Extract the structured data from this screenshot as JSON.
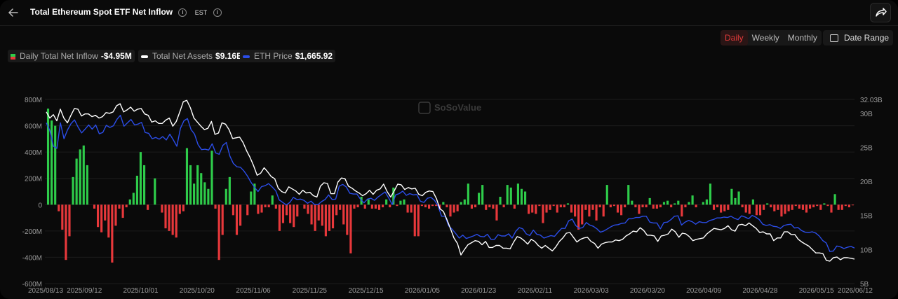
{
  "header": {
    "title": "Total Ethereum Spot ETF Net Inflow",
    "timezone": "EST"
  },
  "controls": {
    "periods": [
      "Daily",
      "Weekly",
      "Monthly"
    ],
    "active_period": "Daily",
    "date_range_label": "Date Range"
  },
  "legend": {
    "items": [
      {
        "label": "Daily Total Net Inflow",
        "value": "-$4.95M"
      },
      {
        "label": "Total Net Assets",
        "value": "$9.16B"
      },
      {
        "label": "ETH Price",
        "value": "$1,665.92"
      }
    ]
  },
  "watermark": "SoSoValue",
  "colors": {
    "positive": "#2ecc4a",
    "negative": "#e8383b",
    "assets_line": "#ffffff",
    "price_line": "#2b4de8",
    "active_tab": "#e23a3a"
  },
  "chart_data": {
    "type": "bar+line",
    "y_left": {
      "ticks": [
        "800M",
        "600M",
        "400M",
        "200M",
        "0",
        "-200M",
        "-400M",
        "-600M"
      ],
      "range": [
        -600,
        800
      ],
      "unit": "M"
    },
    "y_right": {
      "ticks": [
        "32.03B",
        "30B",
        "25B",
        "20B",
        "15B",
        "10B",
        "5B"
      ],
      "range": [
        5,
        32.03
      ],
      "unit": "B"
    },
    "x_ticks": [
      "2025/08/13",
      "2025/09/12",
      "2025/10/01",
      "2025/10/20",
      "2025/11/06",
      "2025/11/25",
      "2025/12/15",
      "2026/01/05",
      "2026/01/23",
      "2026/02/11",
      "2026/03/03",
      "2026/03/20",
      "2026/04/09",
      "2026/04/28",
      "2026/05/15",
      "2026/06/12"
    ],
    "inflow_bars_M": [
      730,
      640,
      600,
      -50,
      -190,
      -420,
      -240,
      210,
      350,
      420,
      450,
      300,
      0,
      -30,
      -170,
      -210,
      -120,
      -250,
      -440,
      -160,
      -30,
      -100,
      -20,
      40,
      90,
      220,
      400,
      300,
      -40,
      0,
      200,
      0,
      -60,
      -180,
      -200,
      -230,
      -250,
      -70,
      -50,
      430,
      300,
      160,
      300,
      240,
      170,
      120,
      410,
      -30,
      -420,
      -230,
      120,
      210,
      -80,
      -230,
      -160,
      0,
      -80,
      100,
      160,
      -70,
      -60,
      -20,
      -20,
      70,
      -30,
      -200,
      -140,
      -80,
      -140,
      -170,
      -90,
      0,
      -30,
      -70,
      -150,
      -200,
      -120,
      -160,
      -240,
      -200,
      -180,
      -80,
      -40,
      -150,
      -230,
      -370,
      -30,
      -20,
      60,
      -30,
      40,
      -30,
      -30,
      -40,
      -20,
      40,
      -20,
      130,
      -10,
      30,
      40,
      -60,
      -60,
      -240,
      -240,
      -10,
      -20,
      -30,
      -10,
      -10,
      -40,
      20,
      -20,
      -90,
      -60,
      -50,
      20,
      40,
      160,
      -30,
      -20,
      90,
      150,
      -40,
      -20,
      -30,
      -120,
      60,
      -20,
      150,
      130,
      -30,
      160,
      120,
      100,
      -70,
      -60,
      -70,
      -10,
      -140,
      -60,
      -40,
      -10,
      -60,
      -20,
      -20,
      10,
      -60,
      -90,
      -190,
      -150,
      -40,
      -90,
      -40,
      -120,
      -20,
      -90,
      150,
      -20,
      -10,
      -60,
      -80,
      -20,
      150,
      30,
      -20,
      -70,
      -20,
      -20,
      50,
      -30,
      -30,
      -20,
      20,
      30,
      -20,
      10,
      30,
      -90,
      -20,
      20,
      70,
      -20,
      0,
      20,
      40,
      160,
      -40,
      -20,
      -60,
      -50,
      -40,
      120,
      50,
      100,
      -20,
      -60,
      -70,
      40,
      -80,
      -80,
      -40,
      10,
      -20,
      -50,
      -40,
      -90,
      -70,
      -50,
      -40,
      -10,
      -30,
      -40,
      -60,
      -30,
      -20,
      -10,
      -40,
      10,
      -10,
      -60,
      80,
      -40,
      -40,
      -10,
      -20,
      -5
    ],
    "total_net_assets_B": [
      30.2,
      29.3,
      29.8,
      28.9,
      30.6,
      29.3,
      28.6,
      29.7,
      30.7,
      30.6,
      29.6,
      29.9,
      29.9,
      29.5,
      29.7,
      29.3,
      29.5,
      30.1,
      30.0,
      30.2,
      31.1,
      31.4,
      30.2,
      30.5,
      30.9,
      30.3,
      30.6,
      30.7,
      29.9,
      29.7,
      28.7,
      28.9,
      28.5,
      28.5,
      29.0,
      29.3,
      28.1,
      28.8,
      30.2,
      31.7,
      31.9,
      30.8,
      29.3,
      28.7,
      28.1,
      27.6,
      27.8,
      28.8,
      26.9,
      27.1,
      28.6,
      28.4,
      27.6,
      26.3,
      26.4,
      26.5,
      25.7,
      24.5,
      23.5,
      22.3,
      20.9,
      21.2,
      22.0,
      21.4,
      20.7,
      20.4,
      19.0,
      18.5,
      18.3,
      19.2,
      18.9,
      18.6,
      18.1,
      18.7,
      18.3,
      18.4,
      17.9,
      17.7,
      19.3,
      19.8,
      19.7,
      18.2,
      18.2,
      19.9,
      20.5,
      20.4,
      19.3,
      19.0,
      18.6,
      18.3,
      17.9,
      18.2,
      18.7,
      18.1,
      18.7,
      18.9,
      19.6,
      18.5,
      17.7,
      18.6,
      19.6,
      19.5,
      18.8,
      19.1,
      18.9,
      19.0,
      18.1,
      17.9,
      18.4,
      18.6,
      18.5,
      17.5,
      16.0,
      15.6,
      14.4,
      13.1,
      11.7,
      10.9,
      9.2,
      10.0,
      10.7,
      11.0,
      11.3,
      11.2,
      10.7,
      11.2,
      10.3,
      10.3,
      10.6,
      10.6,
      10.2,
      10.2,
      10.1,
      11.1,
      11.9,
      11.7,
      11.3,
      10.8,
      11.5,
      11.2,
      10.6,
      10.2,
      10.6,
      10.2,
      9.8,
      10.4,
      11.2,
      11.7,
      12.4,
      12.5,
      11.8,
      11.1,
      11.5,
      11.7,
      11.8,
      11.2,
      10.9,
      10.2,
      10.8,
      11.0,
      11.1,
      11.1,
      11.4,
      11.3,
      11.5,
      12.0,
      12.3,
      12.7,
      12.6,
      13.2,
      12.8,
      12.1,
      12.1,
      12.0,
      11.2,
      12.0,
      12.1,
      12.3,
      13.0,
      12.6,
      11.8,
      12.4,
      12.3,
      11.9,
      11.3,
      11.5,
      11.6,
      11.7,
      12.3,
      12.7,
      13.1,
      13.0,
      12.9,
      13.1,
      13.5,
      12.9,
      12.7,
      13.6,
      13.7,
      13.5,
      13.9,
      13.5,
      13.1,
      12.5,
      12.6,
      12.3,
      12.3,
      11.3,
      11.7,
      11.7,
      12.6,
      12.6,
      12.2,
      12.2,
      11.5,
      11.1,
      10.8,
      10.5,
      10.0,
      9.5,
      9.5,
      9.4,
      8.4,
      8.3,
      8.8,
      8.9,
      8.5,
      8.8,
      8.8,
      8.7,
      8.6
    ],
    "eth_price": [
      4650,
      4470,
      4090,
      4040,
      4650,
      4270,
      4480,
      4630,
      4720,
      4550,
      4410,
      4500,
      4600,
      4500,
      4600,
      4390,
      4420,
      4590,
      4540,
      4580,
      4730,
      4830,
      4570,
      4650,
      4730,
      4600,
      4620,
      4660,
      4420,
      4400,
      4270,
      4300,
      4260,
      4320,
      4240,
      4380,
      4240,
      4090,
      4520,
      4700,
      4750,
      4490,
      4380,
      4130,
      4010,
      4020,
      4000,
      4150,
      3930,
      3900,
      4110,
      4180,
      3860,
      3680,
      3600,
      3590,
      3500,
      3380,
      3230,
      3110,
      3010,
      3130,
      3150,
      3200,
      3120,
      3030,
      2810,
      2750,
      2690,
      2750,
      2870,
      2820,
      2830,
      2800,
      2730,
      2780,
      2700,
      2700,
      2770,
      2820,
      2930,
      2820,
      2830,
      3140,
      3180,
      3120,
      2970,
      2950,
      2950,
      2830,
      2740,
      2830,
      2850,
      2800,
      2880,
      2940,
      3000,
      2860,
      2700,
      2930,
      2960,
      3020,
      2920,
      2960,
      2930,
      2940,
      2780,
      2750,
      2850,
      2870,
      2800,
      2670,
      2420,
      2420,
      2190,
      2110,
      2010,
      1900,
      1970,
      1890,
      1920,
      1950,
      1990,
      1940,
      1930,
      1990,
      1870,
      1870,
      1980,
      1950,
      1950,
      2000,
      1900,
      2060,
      2150,
      2120,
      2000,
      1960,
      2090,
      1990,
      1970,
      1900,
      1930,
      1960,
      1940,
      2040,
      2130,
      2130,
      2310,
      2350,
      2200,
      2130,
      2150,
      2270,
      2210,
      2180,
      2120,
      2040,
      2070,
      2120,
      2170,
      2210,
      2220,
      2250,
      2260,
      2360,
      2360,
      2390,
      2390,
      2420,
      2420,
      2280,
      2260,
      2260,
      2120,
      2270,
      2280,
      2340,
      2420,
      2430,
      2210,
      2280,
      2320,
      2290,
      2230,
      2290,
      2270,
      2270,
      2320,
      2340,
      2380,
      2380,
      2400,
      2390,
      2420,
      2370,
      2340,
      2430,
      2400,
      2360,
      2440,
      2400,
      2340,
      2230,
      2200,
      2220,
      2180,
      2170,
      2130,
      2200,
      2220,
      2230,
      2140,
      2150,
      2080,
      2040,
      2030,
      2050,
      2020,
      1950,
      1840,
      1780,
      1580,
      1590,
      1710,
      1690,
      1650,
      1680,
      1700,
      1660
    ]
  }
}
